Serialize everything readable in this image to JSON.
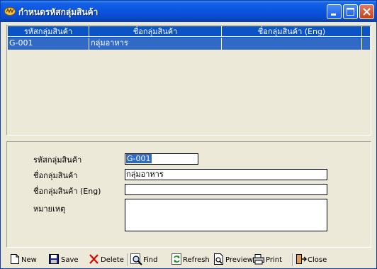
{
  "window": {
    "title": "กำหนดรหัสกลุ่มสินค้า"
  },
  "grid": {
    "columns": [
      "รหัสกลุ่มสินค้า",
      "ชื่อกลุ่มสินค้า",
      "ชื่อกลุ่มสินค้า (Eng)"
    ],
    "rows": [
      {
        "code": "G-001",
        "name": "กลุ่มอาหาร",
        "name_eng": ""
      }
    ]
  },
  "form": {
    "code_label": "รหัสกลุ่มสินค้า",
    "code_value": "G-001",
    "name_label": "ชื่อกลุ่มสินค้า",
    "name_value": "กลุ่มอาหาร",
    "name_eng_label": "ชื่อกลุ่มสินค้า (Eng)",
    "name_eng_value": "",
    "note_label": "หมายเหตุ",
    "note_value": ""
  },
  "toolbar": {
    "new": "New",
    "save": "Save",
    "delete": "Delete",
    "find": "Find",
    "refresh": "Refresh",
    "preview": "Preview",
    "print": "Print",
    "close": "Close"
  },
  "colors": {
    "titlebar": "#0a56e0",
    "grid_header": "#0a54c7",
    "selected_row": "#316ac5",
    "window_bg": "#ece9d8"
  }
}
